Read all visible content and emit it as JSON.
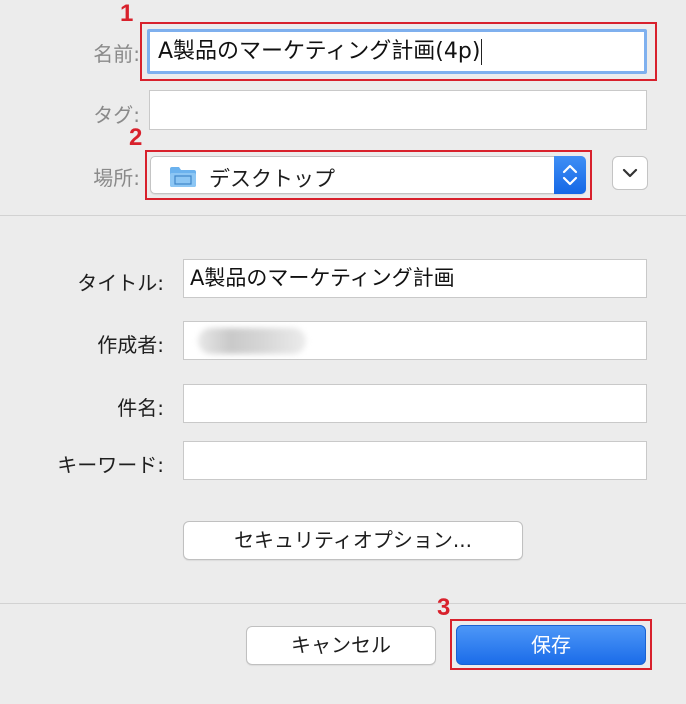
{
  "save_sheet": {
    "name_label": "名前:",
    "name_value": "A製品のマーケティング計画(4p)",
    "tags_label": "タグ:",
    "tags_value": "",
    "location_label": "場所:",
    "location_value": "デスクトップ",
    "location_icon": "folder-icon"
  },
  "metadata": {
    "title_label": "タイトル:",
    "title_value": "A製品のマーケティング計画",
    "author_label": "作成者:",
    "author_value": "",
    "subject_label": "件名:",
    "subject_value": "",
    "keywords_label": "キーワード:",
    "keywords_value": "",
    "security_button": "セキュリティオプション..."
  },
  "actions": {
    "cancel": "キャンセル",
    "save": "保存"
  },
  "annotations": [
    "1",
    "2",
    "3"
  ],
  "colors": {
    "highlight_red": "#d8212c",
    "accent_blue": "#1b6ce9",
    "focus_ring": "#7fb0ee"
  }
}
